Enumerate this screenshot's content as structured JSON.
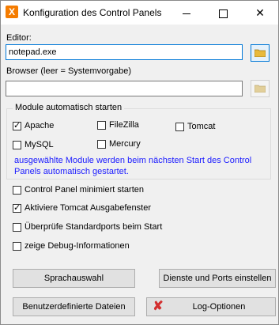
{
  "window": {
    "title": "Konfiguration des Control Panels",
    "icon_letter": "X",
    "controls": {
      "minimize": "—",
      "maximize": "□",
      "close": "✕"
    }
  },
  "editor": {
    "label": "Editor:",
    "value": "notepad.exe"
  },
  "browser": {
    "label": "Browser (leer = Systemvorgabe)",
    "value": ""
  },
  "modules": {
    "legend": "Module automatisch starten",
    "items": [
      {
        "label": "Apache",
        "checked": true
      },
      {
        "label": "FileZilla",
        "checked": false
      },
      {
        "label": "Tomcat",
        "checked": false
      },
      {
        "label": "MySQL",
        "checked": false
      },
      {
        "label": "Mercury",
        "checked": false
      }
    ],
    "info": "ausgewählte Module werden beim nächsten Start des Control Panels automatisch gestartet."
  },
  "options": [
    {
      "label": "Control Panel minimiert starten",
      "checked": false
    },
    {
      "label": "Aktiviere Tomcat Ausgabefenster",
      "checked": true
    },
    {
      "label": "Überprüfe Standardports beim Start",
      "checked": false
    },
    {
      "label": "zeige Debug-Informationen",
      "checked": false
    }
  ],
  "buttons": {
    "language": "Sprachauswahl",
    "services": "Dienste und Ports einstellen",
    "user_files": "Benutzerdefinierte Dateien",
    "log_options": "Log-Optionen"
  },
  "colors": {
    "info_text": "#1a1aff",
    "focus": "#0078d7",
    "xampp_orange": "#f57c00"
  }
}
